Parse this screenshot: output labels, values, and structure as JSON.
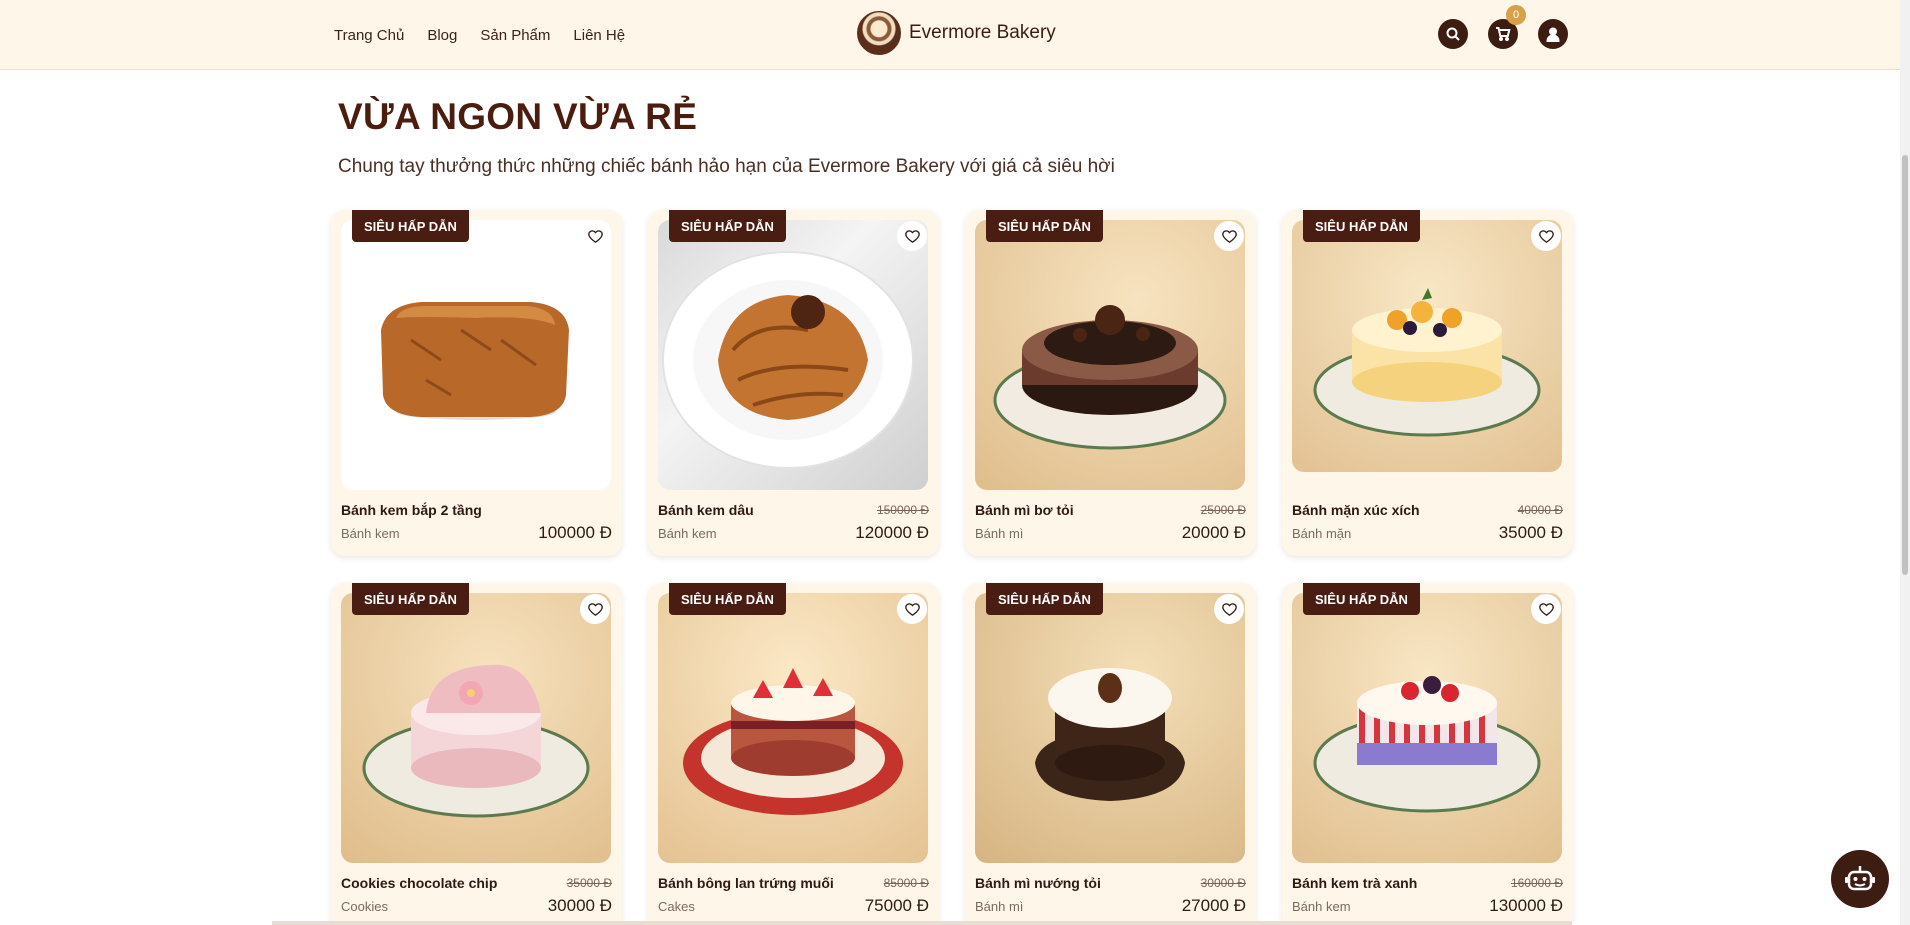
{
  "header": {
    "nav": [
      "Trang Chủ",
      "Blog",
      "Sản Phẩm",
      "Liên Hệ"
    ],
    "brand": "Evermore Bakery",
    "cart_count": "0",
    "icons": [
      "search-icon",
      "cart-icon",
      "user-icon"
    ]
  },
  "section": {
    "title": "VỪA NGON VỪA RẺ",
    "subtitle": "Chung tay thưởng thức những chiếc bánh hảo hạn của Evermore Bakery với giá cả siêu hời"
  },
  "products": [
    {
      "tag": "SIÊU HẤP DẪN",
      "name": "Bánh kem bắp 2 tầng",
      "old_price": "",
      "category": "Bánh kem",
      "price": "100000 Đ"
    },
    {
      "tag": "SIÊU HẤP DẪN",
      "name": "Bánh kem dâu",
      "old_price": "150000 Đ",
      "category": "Bánh kem",
      "price": "120000 Đ"
    },
    {
      "tag": "SIÊU HẤP DẪN",
      "name": "Bánh mì bơ tỏi",
      "old_price": "25000 Đ",
      "category": "Bánh mì",
      "price": "20000 Đ"
    },
    {
      "tag": "SIÊU HẤP DẪN",
      "name": "Bánh mặn xúc xích",
      "old_price": "40000 Đ",
      "category": "Bánh mặn",
      "price": "35000 Đ"
    },
    {
      "tag": "SIÊU HẤP DẪN",
      "name": "Cookies chocolate chip",
      "old_price": "35000 Đ",
      "category": "Cookies",
      "price": "30000 Đ"
    },
    {
      "tag": "SIÊU HẤP DẪN",
      "name": "Bánh bông lan trứng muối",
      "old_price": "85000 Đ",
      "category": "Cakes",
      "price": "75000 Đ"
    },
    {
      "tag": "SIÊU HẤP DẪN",
      "name": "Bánh mì nướng tỏi",
      "old_price": "30000 Đ",
      "category": "Bánh mì",
      "price": "27000 Đ"
    },
    {
      "tag": "SIÊU HẤP DẪN",
      "name": "Bánh kem trà xanh",
      "old_price": "160000 Đ",
      "category": "Bánh kem",
      "price": "130000 Đ"
    }
  ],
  "colors": {
    "brand_dark": "#3d1c12",
    "card_bg": "#fef6e8",
    "badge": "#d9a04a"
  }
}
